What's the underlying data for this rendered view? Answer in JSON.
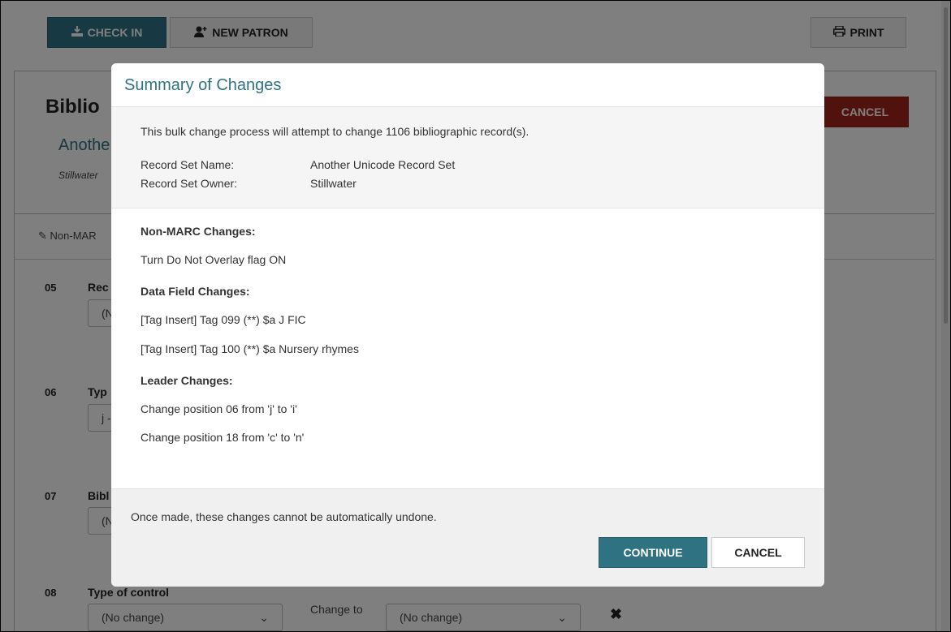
{
  "toolbar": {
    "check_in": "CHECK IN",
    "new_patron": "NEW PATRON",
    "print": "PRINT"
  },
  "page": {
    "title_partial": "Biblio",
    "subtitle_partial": "Anothe",
    "owner_partial": "Stillwater",
    "cancel": "CANCEL",
    "tab_nonmarc_partial": "Non-MAR",
    "fields": [
      {
        "num": "05",
        "label_partial": "Rec",
        "select_partial": "(N"
      },
      {
        "num": "06",
        "label_partial": "Typ",
        "select_partial": "j -"
      },
      {
        "num": "07",
        "label_partial": "Bibl",
        "select_partial": "(N"
      },
      {
        "num": "08",
        "label": "Type of control",
        "select": "(No change)",
        "change_to": "Change to",
        "select2": "(No change)"
      }
    ]
  },
  "modal": {
    "title": "Summary of Changes",
    "intro": "This bulk change process will attempt to change 1106 bibliographic record(s).",
    "record_set_name_label": "Record Set Name:",
    "record_set_name_value": "Another Unicode Record Set",
    "record_set_owner_label": "Record Set Owner:",
    "record_set_owner_value": "Stillwater",
    "sections": {
      "nonmarc_heading": "Non-MARC Changes:",
      "nonmarc_items": [
        "Turn Do Not Overlay flag ON"
      ],
      "datafield_heading": "Data Field Changes:",
      "datafield_items": [
        "[Tag Insert] Tag 099 (**) $a J FIC",
        "[Tag Insert] Tag 100 (**) $a Nursery rhymes"
      ],
      "leader_heading": "Leader Changes:",
      "leader_items": [
        "Change position 06 from 'j' to 'i'",
        "Change position 18 from 'c' to 'n'"
      ]
    },
    "warning": "Once made, these changes cannot be automatically undone.",
    "continue": "CONTINUE",
    "cancel": "CANCEL"
  },
  "icons": {
    "check_in": "download-tray-icon",
    "new_patron": "add-user-icon",
    "print": "printer-icon",
    "edit": "edit-icon",
    "remove": "x-icon"
  }
}
